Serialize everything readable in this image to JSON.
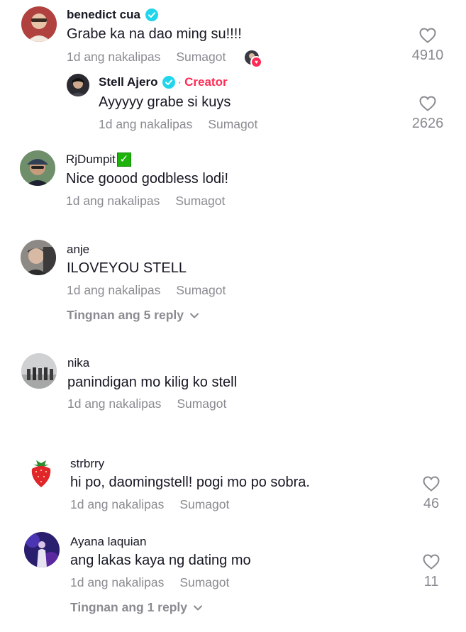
{
  "comments": [
    {
      "username": "benedict cua",
      "text": "Grabe ka na dao ming su!!!!",
      "time": "1d ang nakalipas",
      "reply": "Sumagot",
      "likes": "4910",
      "verified": true,
      "reply_item": {
        "username": "Stell Ajero",
        "dot": "·",
        "badge": "Creator",
        "text": "Ayyyyy grabe si kuys",
        "time": "1d ang nakalipas",
        "reply": "Sumagot",
        "likes": "2626"
      }
    },
    {
      "username": "RjDumpit",
      "badge_glyph": "✓",
      "text": "Nice goood godbless lodi!",
      "time": "1d ang nakalipas",
      "reply": "Sumagot"
    },
    {
      "username": "anje",
      "text": "ILOVEYOU STELL",
      "time": "1d ang nakalipas",
      "reply": "Sumagot",
      "view_replies": "Tingnan ang 5 reply"
    },
    {
      "username": "nika",
      "text": "panindigan mo kilig ko stell",
      "time": "1d ang nakalipas",
      "reply": "Sumagot"
    },
    {
      "username": "strbrry",
      "text": "hi po, daomingstell! pogi mo po sobra.",
      "time": "1d ang nakalipas",
      "reply": "Sumagot",
      "likes": "46"
    },
    {
      "username": "Ayana laquian",
      "text": "ang lakas kaya ng dating mo",
      "time": "1d ang nakalipas",
      "reply": "Sumagot",
      "likes": "11",
      "view_replies": "Tingnan ang 1 reply"
    }
  ],
  "icons": {
    "verified": "verified-badge-icon",
    "like": "heart-outline-icon",
    "chevron": "chevron-down-icon"
  },
  "colors": {
    "text": "#161823",
    "muted": "#8a8b91",
    "creator": "#fe2c55",
    "verified": "#20d5ec"
  }
}
